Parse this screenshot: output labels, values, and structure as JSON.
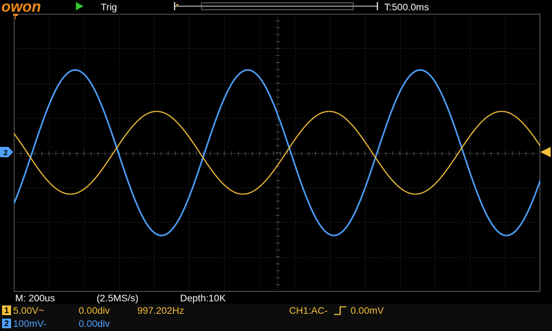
{
  "header": {
    "logo": "owon",
    "trigger_status": "Trig",
    "time_position": "T:500.0ms"
  },
  "acquisition": {
    "timebase": "M: 200us",
    "sample_rate": "(2.5MS/s)",
    "depth": "Depth:10K"
  },
  "channel1": {
    "number": "1",
    "scale": "5.00V~",
    "offset": "0.00div",
    "frequency": "997.202Hz",
    "trigger_info": "CH1:AC-",
    "trigger_level": "0.00mV",
    "color": "#f5c03a"
  },
  "channel2": {
    "number": "2",
    "scale": "100mV-",
    "offset": "0.00div",
    "color": "#4fa3ff"
  },
  "markers": {
    "ch2_ground": "2",
    "ch1_ground_icon": "arrow-left-icon"
  },
  "chart_data": {
    "type": "line",
    "series": [
      {
        "color": "#f5c03a",
        "frequency_hz": 997.202,
        "amplitude_div": 1.2,
        "phase": "falling at left edge"
      },
      {
        "color": "#4fa3ff",
        "frequency_hz": 997.202,
        "amplitude_div": 2.4,
        "phase": "rising at left edge"
      }
    ],
    "grid": true,
    "divisions": {
      "x": 15,
      "y": 8
    }
  }
}
